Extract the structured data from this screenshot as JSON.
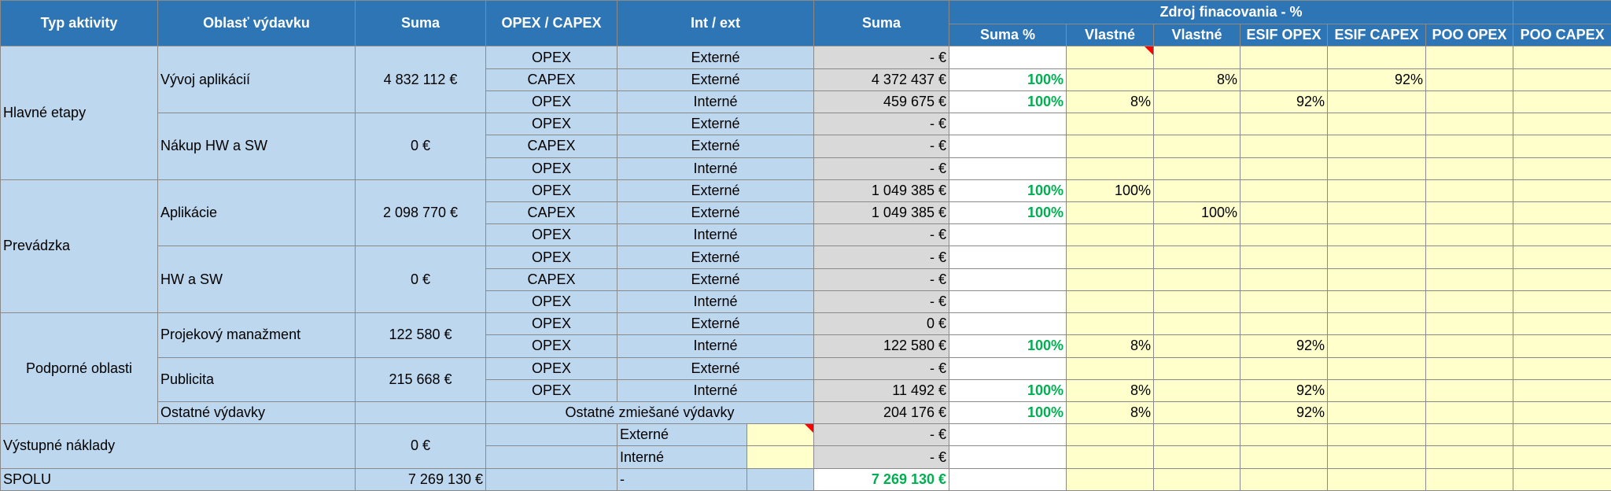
{
  "header": {
    "typ": "Typ aktivity",
    "oblast": "Oblasť výdavku",
    "suma": "Suma",
    "opex_capex": "OPEX / CAPEX",
    "int_ext": "Int / ext",
    "suma2": "Suma",
    "zdroj": "Zdroj finacovania - %",
    "cols": [
      "Suma %",
      "Vlastné",
      "Vlastné",
      "ESIF OPEX",
      "ESIF CAPEX",
      "POO OPEX",
      "POO CAPEX"
    ]
  },
  "groups": {
    "hlavne": "Hlavné etapy",
    "prevadzka": "Prevádzka",
    "podporne": "Podporné oblasti",
    "vystupne": "Výstupné náklady",
    "spolu": "SPOLU"
  },
  "areas": {
    "vyvoj": {
      "name": "Vývoj aplikácií",
      "suma": "4 832 112 €"
    },
    "nakup": {
      "name": "Nákup HW a SW",
      "suma": "0 €"
    },
    "aplikacie": {
      "name": "Aplikácie",
      "suma": "2 098 770 €"
    },
    "hwsw": {
      "name": "HW a SW",
      "suma": "0 €"
    },
    "projekt": {
      "name": "Projekový manažment",
      "suma": "122 580 €"
    },
    "publicita": {
      "name": "Publicita",
      "suma": "215 668 €"
    },
    "ostatne": {
      "name": "Ostatné výdavky",
      "mixed": "Ostatné zmiešané výdavky"
    },
    "vystupne_suma": "0 €",
    "spolu_suma": "7 269 130 €"
  },
  "rows": [
    {
      "type": "OPEX",
      "ie": "Externé",
      "amount": "- €",
      "pct": "",
      "v1": "",
      "v2": "",
      "esif_opex": "",
      "esif_capex": "",
      "poo_opex": "",
      "poo_capex": ""
    },
    {
      "type": "CAPEX",
      "ie": "Externé",
      "amount": "4 372 437 €",
      "pct": "100%",
      "v1": "",
      "v2": "8%",
      "esif_opex": "",
      "esif_capex": "92%",
      "poo_opex": "",
      "poo_capex": ""
    },
    {
      "type": "OPEX",
      "ie": "Interné",
      "amount": "459 675 €",
      "pct": "100%",
      "v1": "8%",
      "v2": "",
      "esif_opex": "92%",
      "esif_capex": "",
      "poo_opex": "",
      "poo_capex": ""
    },
    {
      "type": "OPEX",
      "ie": "Externé",
      "amount": "- €",
      "pct": "",
      "v1": "",
      "v2": "",
      "esif_opex": "",
      "esif_capex": "",
      "poo_opex": "",
      "poo_capex": ""
    },
    {
      "type": "CAPEX",
      "ie": "Externé",
      "amount": "- €",
      "pct": "",
      "v1": "",
      "v2": "",
      "esif_opex": "",
      "esif_capex": "",
      "poo_opex": "",
      "poo_capex": ""
    },
    {
      "type": "OPEX",
      "ie": "Interné",
      "amount": "- €",
      "pct": "",
      "v1": "",
      "v2": "",
      "esif_opex": "",
      "esif_capex": "",
      "poo_opex": "",
      "poo_capex": ""
    },
    {
      "type": "OPEX",
      "ie": "Externé",
      "amount": "1 049 385 €",
      "pct": "100%",
      "v1": "100%",
      "v2": "",
      "esif_opex": "",
      "esif_capex": "",
      "poo_opex": "",
      "poo_capex": ""
    },
    {
      "type": "CAPEX",
      "ie": "Externé",
      "amount": "1 049 385 €",
      "pct": "100%",
      "v1": "",
      "v2": "100%",
      "esif_opex": "",
      "esif_capex": "",
      "poo_opex": "",
      "poo_capex": ""
    },
    {
      "type": "OPEX",
      "ie": "Interné",
      "amount": "- €",
      "pct": "",
      "v1": "",
      "v2": "",
      "esif_opex": "",
      "esif_capex": "",
      "poo_opex": "",
      "poo_capex": ""
    },
    {
      "type": "OPEX",
      "ie": "Externé",
      "amount": "- €",
      "pct": "",
      "v1": "",
      "v2": "",
      "esif_opex": "",
      "esif_capex": "",
      "poo_opex": "",
      "poo_capex": ""
    },
    {
      "type": "CAPEX",
      "ie": "Externé",
      "amount": "- €",
      "pct": "",
      "v1": "",
      "v2": "",
      "esif_opex": "",
      "esif_capex": "",
      "poo_opex": "",
      "poo_capex": ""
    },
    {
      "type": "OPEX",
      "ie": "Interné",
      "amount": "- €",
      "pct": "",
      "v1": "",
      "v2": "",
      "esif_opex": "",
      "esif_capex": "",
      "poo_opex": "",
      "poo_capex": ""
    },
    {
      "type": "OPEX",
      "ie": "Externé",
      "amount": "0 €",
      "pct": "",
      "v1": "",
      "v2": "",
      "esif_opex": "",
      "esif_capex": "",
      "poo_opex": "",
      "poo_capex": ""
    },
    {
      "type": "OPEX",
      "ie": "Interné",
      "amount": "122 580 €",
      "pct": "100%",
      "v1": "8%",
      "v2": "",
      "esif_opex": "92%",
      "esif_capex": "",
      "poo_opex": "",
      "poo_capex": ""
    },
    {
      "type": "OPEX",
      "ie": "Externé",
      "amount": "- €",
      "pct": "",
      "v1": "",
      "v2": "",
      "esif_opex": "",
      "esif_capex": "",
      "poo_opex": "",
      "poo_capex": ""
    },
    {
      "type": "OPEX",
      "ie": "Interné",
      "amount": "11 492 €",
      "pct": "100%",
      "v1": "8%",
      "v2": "",
      "esif_opex": "92%",
      "esif_capex": "",
      "poo_opex": "",
      "poo_capex": ""
    },
    {
      "type": "",
      "ie": "",
      "amount": "204 176 €",
      "pct": "100%",
      "v1": "8%",
      "v2": "",
      "esif_opex": "92%",
      "esif_capex": "",
      "poo_opex": "",
      "poo_capex": ""
    },
    {
      "type": "",
      "ie": "Externé",
      "amount": "- €",
      "pct": "",
      "v1": "",
      "v2": "",
      "esif_opex": "",
      "esif_capex": "",
      "poo_opex": "",
      "poo_capex": ""
    },
    {
      "type": "",
      "ie": "Interné",
      "amount": "- €",
      "pct": "",
      "v1": "",
      "v2": "",
      "esif_opex": "",
      "esif_capex": "",
      "poo_opex": "",
      "poo_capex": ""
    },
    {
      "type": "",
      "ie": "-",
      "amount": "7 269 130 €",
      "pct": "",
      "v1": "",
      "v2": "",
      "esif_opex": "",
      "esif_capex": "",
      "poo_opex": "",
      "poo_capex": ""
    }
  ]
}
